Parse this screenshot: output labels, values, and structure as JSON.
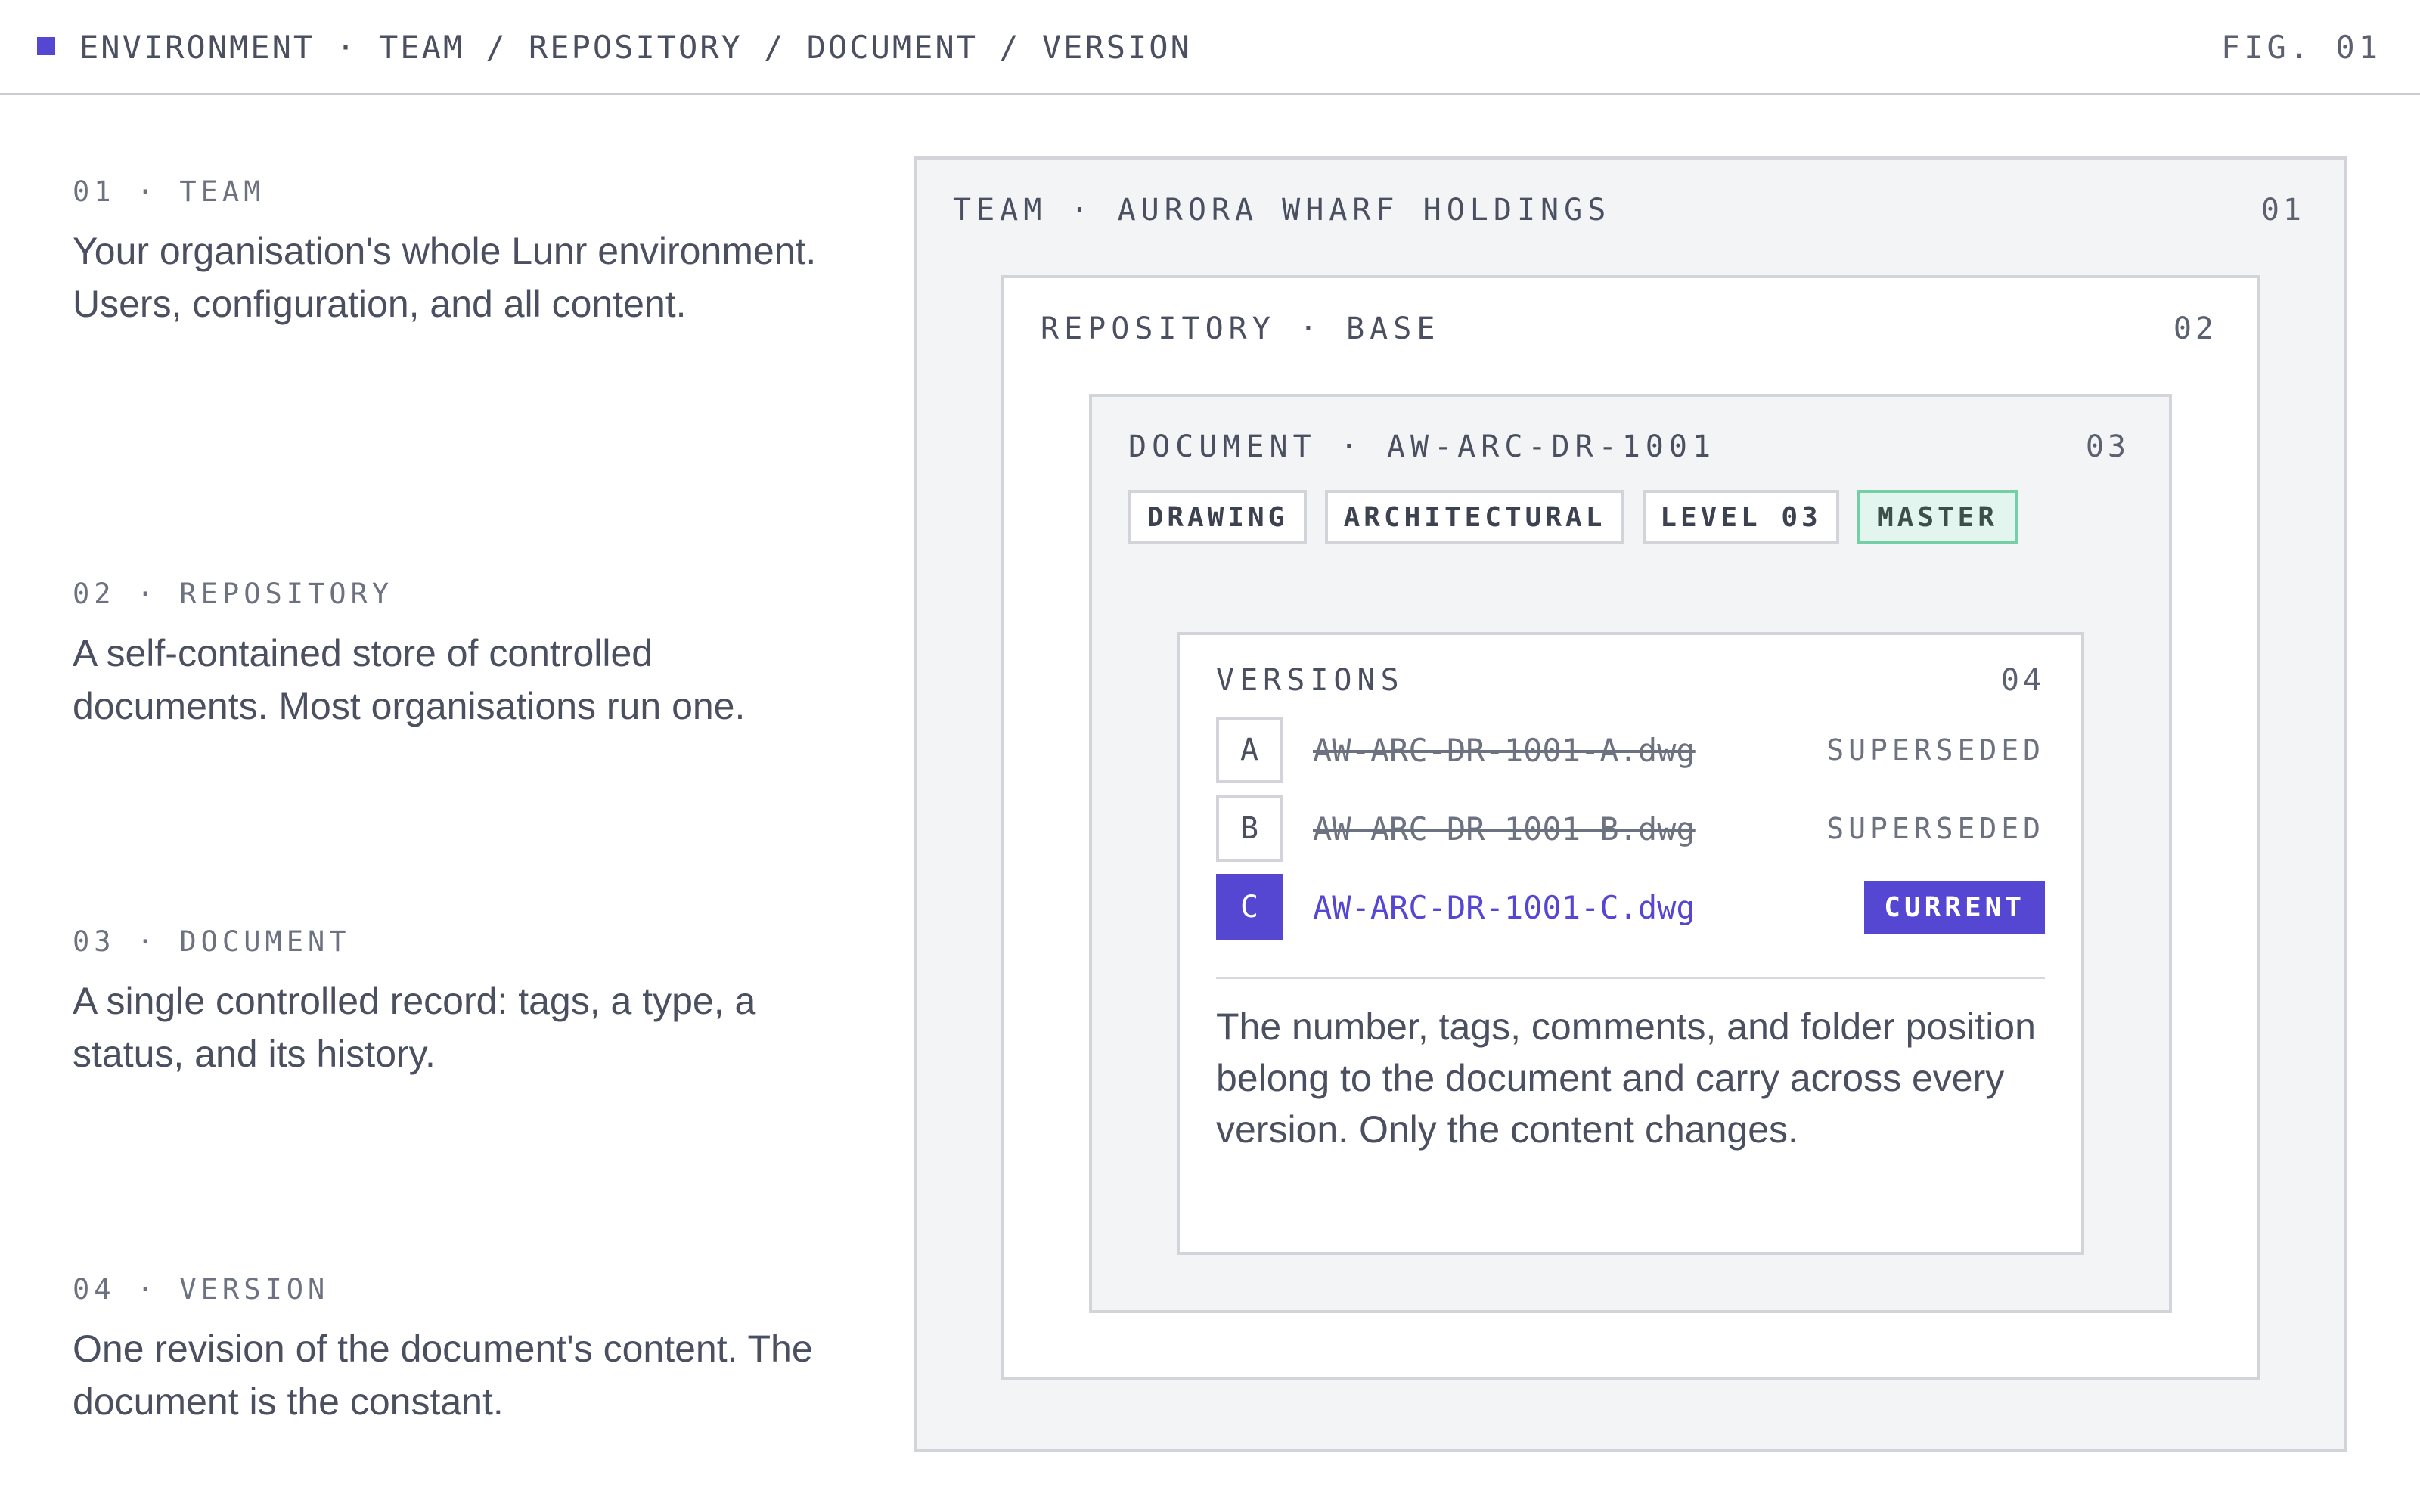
{
  "header": {
    "breadcrumb": "ENVIRONMENT · TEAM / REPOSITORY / DOCUMENT / VERSION",
    "figure": "FIG. 01"
  },
  "descriptions": [
    {
      "label": "01 · TEAM",
      "text": "Your organisation's whole Lunr environment. Users, configuration, and all content."
    },
    {
      "label": "02 · REPOSITORY",
      "text": "A self-contained store of controlled documents. Most organisations run one."
    },
    {
      "label": "03 · DOCUMENT",
      "text": "A single controlled record: tags, a type, a status, and its history."
    },
    {
      "label": "04 · VERSION",
      "text": "One revision of the document's content. The document is the constant."
    }
  ],
  "team": {
    "label": "TEAM · AURORA WHARF HOLDINGS",
    "number": "01"
  },
  "repository": {
    "label": "REPOSITORY · BASE",
    "number": "02"
  },
  "document": {
    "label": "DOCUMENT · AW-ARC-DR-1001",
    "number": "03",
    "tags": [
      "DRAWING",
      "ARCHITECTURAL",
      "LEVEL 03",
      "MASTER"
    ]
  },
  "versions": {
    "label": "VERSIONS",
    "number": "04",
    "rows": [
      {
        "letter": "A",
        "file": "AW-ARC-DR-1001-A.dwg",
        "status": "SUPERSEDED"
      },
      {
        "letter": "B",
        "file": "AW-ARC-DR-1001-B.dwg",
        "status": "SUPERSEDED"
      },
      {
        "letter": "C",
        "file": "AW-ARC-DR-1001-C.dwg",
        "status": "CURRENT"
      }
    ],
    "note": "The number, tags, comments, and folder position belong to the document and carry across every version. Only the content changes."
  },
  "colors": {
    "accent": "#5547d2",
    "master_tag_bg": "#e2f5ee",
    "master_tag_border": "#74cfa6",
    "panel_grey": "#f3f4f6"
  }
}
